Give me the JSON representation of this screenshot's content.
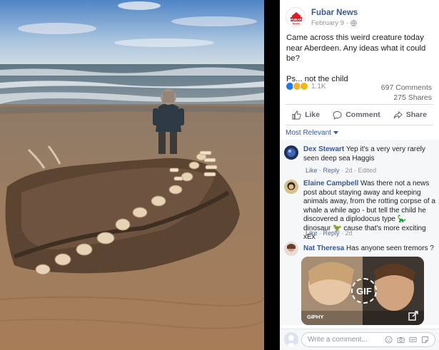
{
  "post": {
    "page_name": "Fubar News",
    "date": "February 9",
    "meta_sep": "·",
    "logo_text": "FUBAR",
    "logo_sub": "NEWS",
    "text_line1": "Came across this weird creature today near Aberdeen. Any ideas what it could be?",
    "text_line2": "Ps... not the child",
    "reaction_count": "1.1K",
    "comments_count": "697 Comments",
    "shares_count": "275 Shares",
    "brand_color": "#e31b23",
    "link_color": "#385898"
  },
  "actions": {
    "like": "Like",
    "comment": "Comment",
    "share": "Share"
  },
  "sort": {
    "label": "Most Relevant"
  },
  "comments": [
    {
      "author": "Dex Stewart",
      "text": "Yep it's a very very rarely seen deep sea Haggis",
      "like": "Like",
      "reply": "Reply",
      "time": "2d",
      "edited": "Edited"
    },
    {
      "author": "Elaine Campbell",
      "text": "Was there not a news post about staying away and keeping animals away, from the rotting corpse of a whale a while ago - but tell the child he discovered a diplodocus type 🦕 dinosaur 🦖 cause that's more exciting xEx",
      "like": "Like",
      "reply": "Reply",
      "time": "2d"
    },
    {
      "author": "Nat Theresa",
      "text": "Has anyone seen tremors ?"
    }
  ],
  "gif": {
    "badge": "GIF",
    "source": "GIPHY"
  },
  "composer": {
    "placeholder": "Write a comment..."
  }
}
